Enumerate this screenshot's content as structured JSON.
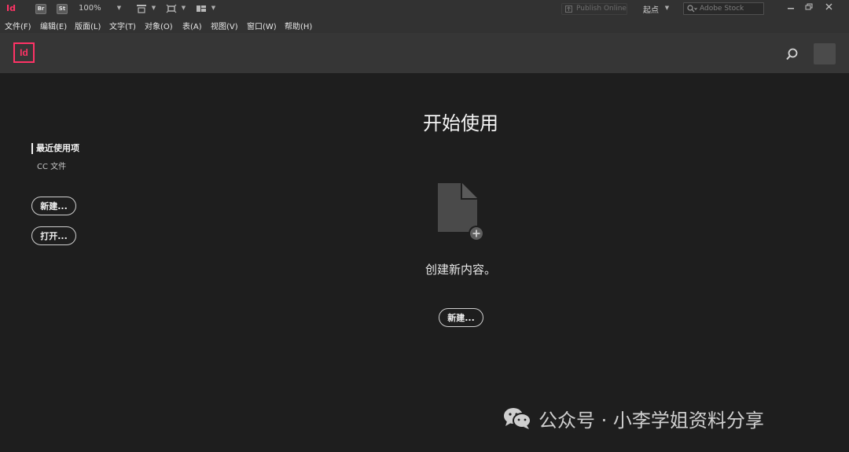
{
  "toolbar": {
    "app_logo": "Id",
    "bridge_badge": "Br",
    "stock_badge": "St",
    "zoom": "100%",
    "publish_label": "Publish Online",
    "workspace_label": "起点",
    "stock_search_placeholder": "Adobe Stock",
    "accent_color": "#ff3366"
  },
  "menu": {
    "items": [
      "文件(F)",
      "编辑(E)",
      "版面(L)",
      "文字(T)",
      "对象(O)",
      "表(A)",
      "视图(V)",
      "窗口(W)",
      "帮助(H)"
    ]
  },
  "header": {
    "logo": "Id"
  },
  "sidebar": {
    "recent": "最近使用项",
    "cc_files": "CC 文件",
    "new_button": "新建...",
    "open_button": "打开..."
  },
  "main": {
    "title": "开始使用",
    "create_text": "创建新内容。",
    "new_button": "新建..."
  },
  "watermark": {
    "text": "公众号 · 小李学姐资料分享"
  }
}
